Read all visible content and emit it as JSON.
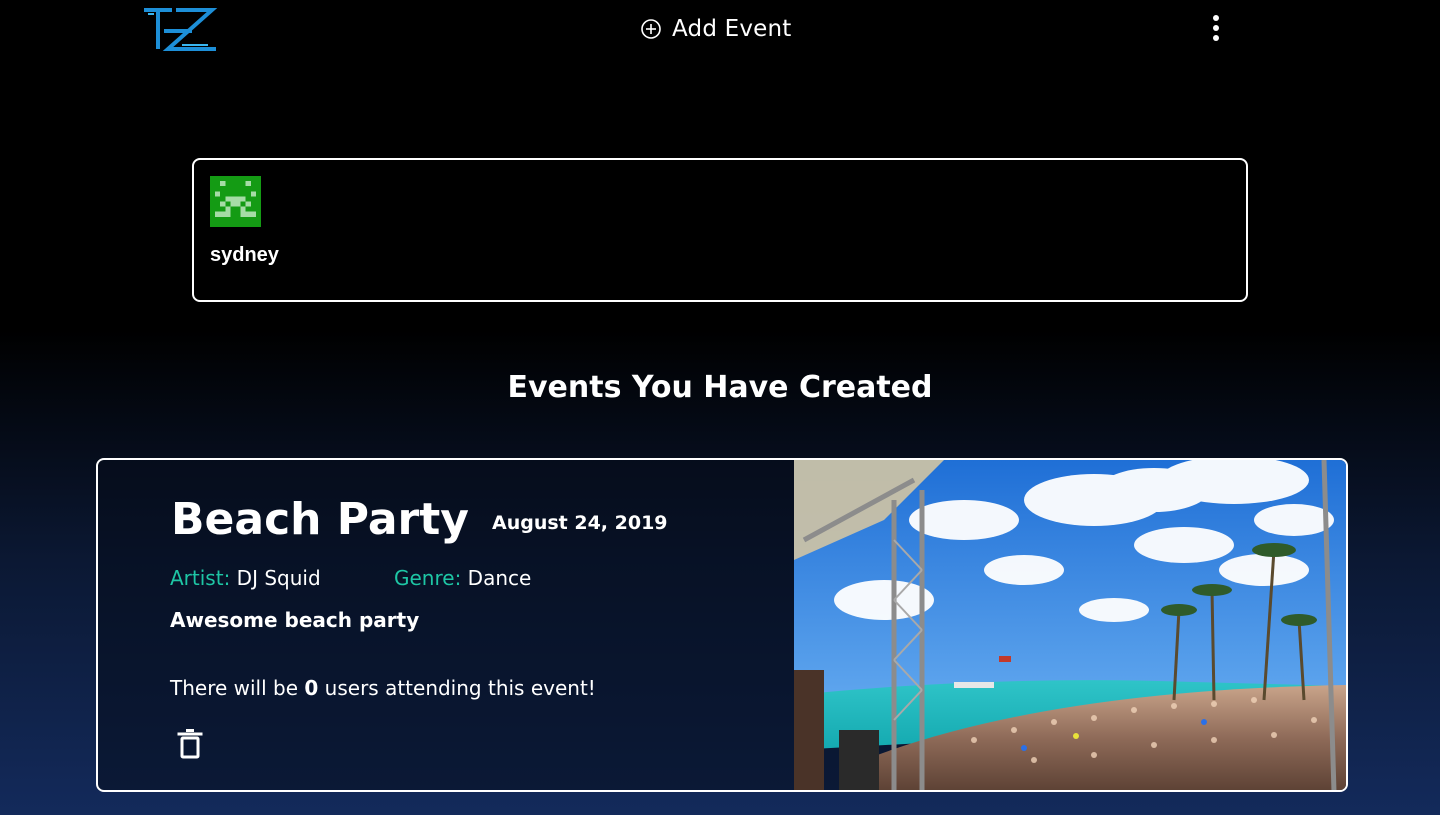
{
  "header": {
    "logo_icon": "tz-logo-icon",
    "add_event_label": "Add Event",
    "add_event_icon": "circle-plus-icon",
    "menu_icon": "kebab-menu-icon"
  },
  "profile": {
    "avatar_icon": "pixel-avatar-icon",
    "username": "sydney"
  },
  "events_section": {
    "title": "Events You Have Created"
  },
  "events": [
    {
      "title": "Beach Party",
      "date": "August 24, 2019",
      "artist_label": "Artist:",
      "artist": "DJ Squid",
      "genre_label": "Genre:",
      "genre": "Dance",
      "description": "Awesome beach party",
      "attending_prefix": "There will be ",
      "attending_count": "0",
      "attending_suffix": " users attending this event!",
      "delete_icon": "trash-icon",
      "image_description_icon": "beach-crowd-photo"
    }
  ],
  "colors": {
    "accent_teal": "#1ec6a5",
    "logo_blue": "#1d8fd8",
    "avatar_green": "#149b14",
    "background_top": "#000000",
    "background_bottom": "#132a5b"
  }
}
